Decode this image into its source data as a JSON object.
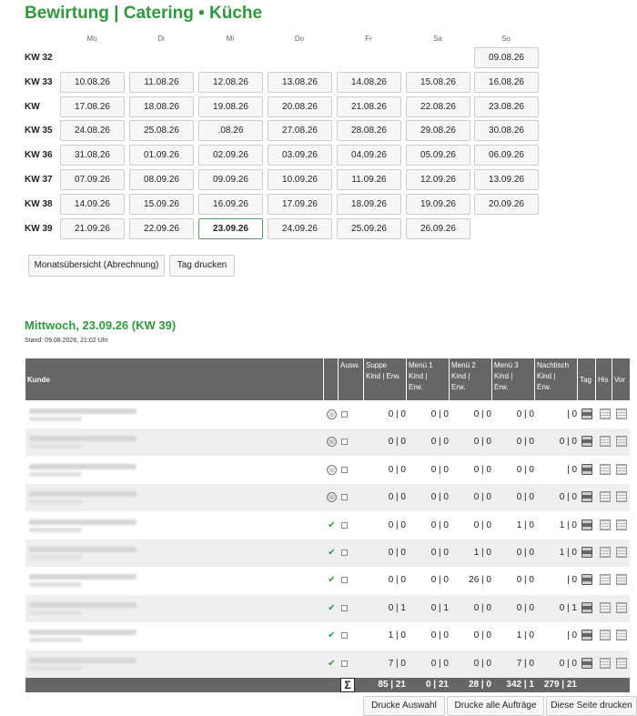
{
  "title": "Bewirtung | Catering • Küche",
  "weekdays": [
    "Mo",
    "Di",
    "Mi",
    "Do",
    "Fr",
    "Sa",
    "So"
  ],
  "weeks": [
    {
      "kw": "KW 32",
      "days": [
        "",
        "",
        "",
        "",
        "",
        "",
        "09.08.26"
      ]
    },
    {
      "kw": "KW 33",
      "days": [
        "10.08.26",
        "11.08.26",
        "12.08.26",
        "13.08.26",
        "14.08.26",
        "15.08.26",
        "16.08.26"
      ]
    },
    {
      "kw": "KW",
      "days": [
        "17.08.26",
        "18.08.26",
        "19.08.26",
        "20.08.26",
        "21.08.26",
        "22.08.26",
        "23.08.26"
      ]
    },
    {
      "kw": "KW 35",
      "days": [
        "24.08.26",
        "25.08.26",
        ".08.26",
        "27.08.26",
        "28.08.26",
        "29.08.26",
        "30.08.26"
      ]
    },
    {
      "kw": "KW 36",
      "days": [
        "31.08.26",
        "01.09.26",
        "02.09.26",
        "03.09.26",
        "04.09.26",
        "05.09.26",
        "06.09.26"
      ]
    },
    {
      "kw": "KW 37",
      "days": [
        "07.09.26",
        "08.09.26",
        "09.09.26",
        "10.09.26",
        "11.09.26",
        "12.09.26",
        "13.09.26"
      ]
    },
    {
      "kw": "KW 38",
      "days": [
        "14.09.26",
        "15.09.26",
        "16.09.26",
        "17.09.26",
        "18.09.26",
        "19.09.26",
        "20.09.26"
      ]
    },
    {
      "kw": "KW 39",
      "days": [
        "21.09.26",
        "22.09.26",
        "23.09.26",
        "24.09.26",
        "25.09.26",
        "26.09.26",
        ""
      ]
    }
  ],
  "selected_day": "23.09.26",
  "buttons": {
    "monthly": "Monatsübersicht (Abrechnung)",
    "print_day": "Tag drucken"
  },
  "day_title": "Mittwoch, 23.09.26",
  "day_kw": "(KW 39)",
  "stand": "Stand: 09.08.2026, 21:02 Uhr",
  "headers": {
    "kunde": "Kunde",
    "ausw": "Ausw.",
    "suppe": [
      "Suppe",
      "Kind | Erw."
    ],
    "menu1": [
      "Menü 1",
      "Kind |",
      "Erw."
    ],
    "menu2": [
      "Menü 2",
      "Kind |",
      "Erw."
    ],
    "menu3": [
      "Menü 3",
      "Kind |",
      "Erw."
    ],
    "nachtisch": [
      "Nachtisch",
      "Kind |",
      "Erw."
    ],
    "tag": "Tag",
    "his": "His",
    "vor": "Vor"
  },
  "rows": [
    {
      "status": "phone",
      "suppe": "0 | 0",
      "menu1": "0 | 0",
      "menu2": "0 | 0",
      "menu3": "0 | 0",
      "nachtisch": "| 0"
    },
    {
      "status": "phone",
      "suppe": "0 | 0",
      "menu1": "0 | 0",
      "menu2": "0 | 0",
      "menu3": "0 | 0",
      "nachtisch": "0 | 0"
    },
    {
      "status": "phone",
      "suppe": "0 | 0",
      "menu1": "0 | 0",
      "menu2": "0 | 0",
      "menu3": "0 | 0",
      "nachtisch": "| 0"
    },
    {
      "status": "phone",
      "suppe": "0 | 0",
      "menu1": "0 | 0",
      "menu2": "0 | 0",
      "menu3": "0 | 0",
      "nachtisch": "0 | 0"
    },
    {
      "status": "check",
      "suppe": "0 | 0",
      "menu1": "0 | 0",
      "menu2": "0 | 0",
      "menu3": "1 | 0",
      "nachtisch": "1 | 0"
    },
    {
      "status": "check",
      "suppe": "0 | 0",
      "menu1": "0 | 0",
      "menu2": "1 | 0",
      "menu3": "0 | 0",
      "nachtisch": "1 | 0"
    },
    {
      "status": "check",
      "suppe": "0 | 0",
      "menu1": "0 | 0",
      "menu2": "26 | 0",
      "menu3": "0 | 0",
      "nachtisch": "| 0"
    },
    {
      "status": "check",
      "suppe": "0 | 1",
      "menu1": "0 | 1",
      "menu2": "0 | 0",
      "menu3": "0 | 0",
      "nachtisch": "0 | 1"
    },
    {
      "status": "check",
      "suppe": "1 | 0",
      "menu1": "0 | 0",
      "menu2": "0 | 0",
      "menu3": "1 | 0",
      "nachtisch": "| 0"
    },
    {
      "status": "check",
      "suppe": "7 | 0",
      "menu1": "0 | 0",
      "menu2": "0 | 0",
      "menu3": "7 | 0",
      "nachtisch": "0 | 0"
    }
  ],
  "sums": {
    "sigma": "Σ",
    "suppe": "85 | 21",
    "menu1": "0 | 21",
    "menu2": "28 | 0",
    "menu3": "342 | 1",
    "nachtisch": "279 | 21"
  },
  "footer_buttons": {
    "print_selection": "Drucke Auswahl",
    "print_all": "Drucke alle Aufträge",
    "print_page": "Diese Seite drucken"
  }
}
